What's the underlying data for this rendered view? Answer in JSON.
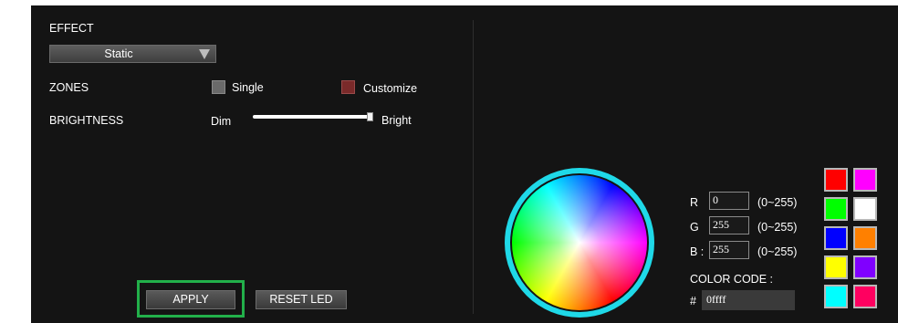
{
  "effect": {
    "label": "EFFECT",
    "selected": "Static"
  },
  "zones": {
    "label": "ZONES",
    "single": "Single",
    "customize": "Customize"
  },
  "brightness": {
    "label": "BRIGHTNESS",
    "min_label": "Dim",
    "max_label": "Bright",
    "level": 1.0
  },
  "buttons": {
    "apply": "APPLY",
    "reset": "RESET LED"
  },
  "rgb": {
    "r_label": "R",
    "r_value": "0",
    "g_label": "G",
    "g_value": "255",
    "b_label": "B :",
    "b_value": "255",
    "range": "(0~255)"
  },
  "color_code": {
    "label": "COLOR CODE :",
    "hash": "#",
    "value": "0ffff"
  },
  "swatches": [
    "#ff0000",
    "#ff00ff",
    "#00ff00",
    "#ffffff",
    "#0000ff",
    "#ff8000",
    "#ffff00",
    "#8000ff",
    "#00ffff",
    "#ff0060"
  ],
  "colors": {
    "highlight": "#22b04a",
    "wheel_ring": "#1fd9e8",
    "customize_box": "#7a2a2a",
    "single_box": "#6a6a6a"
  }
}
